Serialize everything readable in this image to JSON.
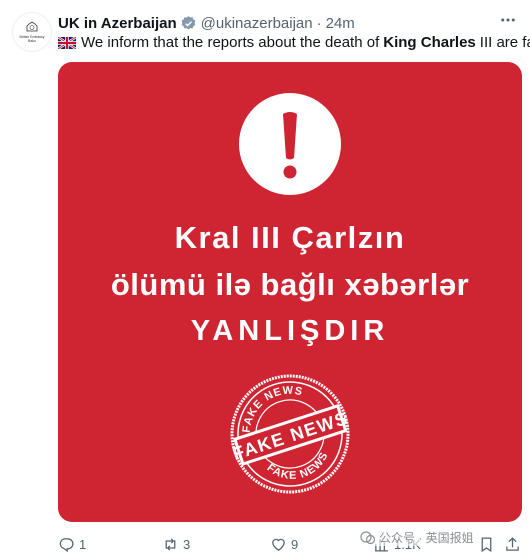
{
  "tweet": {
    "author_name": "UK in Azerbaijan",
    "handle": "@ukinazerbaijan",
    "separator": "·",
    "time": "24m",
    "avatar_text": "British Embassy Baku",
    "text_before": "We inform that the reports about the death of",
    "text_bold": "King Charles",
    "text_after": "III are fake!",
    "flag_icon": "uk-flag-icon"
  },
  "image": {
    "background": "#cf2532",
    "line1": "Kral III Çarlzın",
    "line2": "ölümü ilə bağlı xəbərlər",
    "line3": "YANLIŞDIR",
    "stamp_top": "FAKE NEWS",
    "stamp_center": "FAKE NEWS",
    "stamp_bottom": "FAKE NEWS"
  },
  "actions": {
    "reply_count": "1",
    "retweet_count": "3",
    "like_count": "9",
    "views_count": "1.1K"
  },
  "watermark": {
    "text": "公众号 · 英国报姐"
  },
  "colors": {
    "verified": "#829aab",
    "muted": "#536471",
    "accent_red": "#cf2532"
  }
}
